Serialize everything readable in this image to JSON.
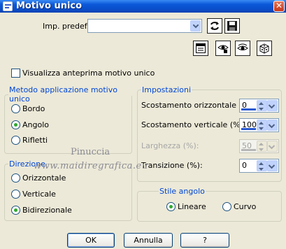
{
  "window": {
    "title": "Motivo unico",
    "close_glyph": "✕"
  },
  "preset": {
    "label": "Imp. predef.:",
    "value": ""
  },
  "preview_checkbox": {
    "label": "Visualizza anteprima motivo unico",
    "checked": false
  },
  "method_group": {
    "legend": "Metodo applicazione motivo unico",
    "options": [
      {
        "label": "Bordo",
        "selected": false
      },
      {
        "label": "Angolo",
        "selected": true
      },
      {
        "label": "Rifletti",
        "selected": false
      }
    ]
  },
  "direction_group": {
    "legend": "Direzione",
    "options": [
      {
        "label": "Orizzontale",
        "selected": false
      },
      {
        "label": "Verticale",
        "selected": false
      },
      {
        "label": "Bidirezionale",
        "selected": true
      }
    ]
  },
  "settings_group": {
    "legend": "Impostazioni",
    "fields": [
      {
        "label": "Scostamento orizzontale (%):",
        "value": "0",
        "enabled": true
      },
      {
        "label": "Scostamento verticale (%):",
        "value": "100",
        "enabled": true
      },
      {
        "label": "Larghezza (%):",
        "value": "50",
        "enabled": false
      },
      {
        "label": "Transizione (%):",
        "value": "0",
        "enabled": true
      }
    ]
  },
  "corner_style_group": {
    "legend": "Stile angolo",
    "options": [
      {
        "label": "Lineare",
        "selected": true
      },
      {
        "label": "Curvo",
        "selected": false
      }
    ]
  },
  "watermark": {
    "line1": "Pinuccia",
    "line2": "www.maidiregrafica.eu"
  },
  "buttons": {
    "ok": "OK",
    "cancel": "Annulla",
    "help": "?"
  },
  "colors": {
    "titlebar": "#0a4fcb",
    "group_legend": "#0046d5",
    "dialog_bg": "#ece9d8",
    "radio_dot": "#2fa82f"
  }
}
